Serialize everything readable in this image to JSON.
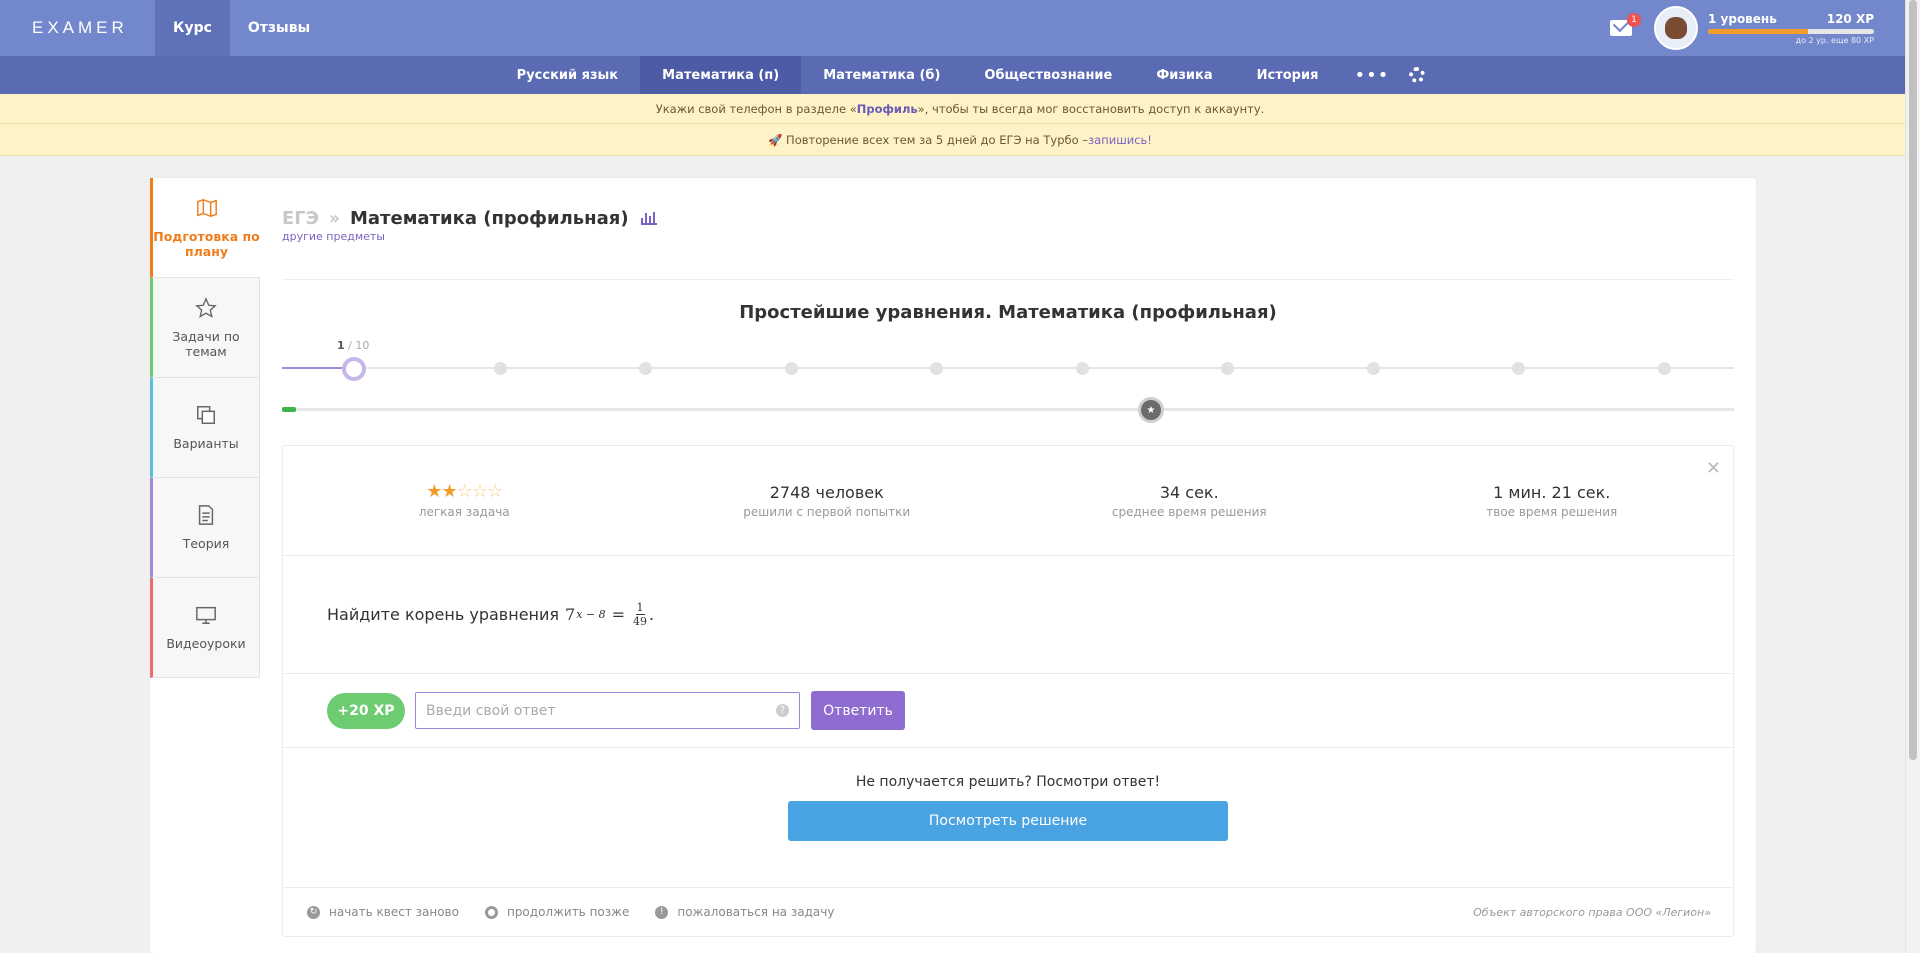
{
  "header": {
    "logo": "EXAMER",
    "nav": [
      {
        "label": "Курс",
        "active": true
      },
      {
        "label": "Отзывы",
        "active": false
      }
    ],
    "mail_count": "1",
    "level_label": "1 уровень",
    "xp_label": "120 XP",
    "level_progress": 0.6,
    "level_note": "до 2 ур. еще 80 XP"
  },
  "subjects": [
    {
      "label": "Русский язык",
      "active": false
    },
    {
      "label": "Математика (п)",
      "active": true
    },
    {
      "label": "Математика (б)",
      "active": false
    },
    {
      "label": "Обществознание",
      "active": false
    },
    {
      "label": "Физика",
      "active": false
    },
    {
      "label": "История",
      "active": false
    }
  ],
  "subjects_more": "•••",
  "notices": {
    "phone_pre": "Укажи свой телефон в разделе «",
    "phone_link": "Профиль",
    "phone_post": "», чтобы ты всегда мог восстановить доступ к аккаунту.",
    "turbo_text": "🚀 Повторение всех тем за 5 дней до ЕГЭ на Турбо – ",
    "turbo_link": "запишись!"
  },
  "sidebar": [
    {
      "label": "Подготовка по плану",
      "color": "#ef7d1c",
      "active": true,
      "icon": "map-icon"
    },
    {
      "label": "Задачи по темам",
      "color": "#6dcc72",
      "active": false,
      "icon": "star-icon"
    },
    {
      "label": "Варианты",
      "color": "#5bc0de",
      "active": false,
      "icon": "copy-icon"
    },
    {
      "label": "Теория",
      "color": "#a48bd8",
      "active": false,
      "icon": "document-icon"
    },
    {
      "label": "Видеоуроки",
      "color": "#ef6a6a",
      "active": false,
      "icon": "monitor-icon"
    }
  ],
  "breadcrumb": {
    "root": "ЕГЭ",
    "separator": "»",
    "subject": "Математика (профильная)",
    "other": "другие предметы"
  },
  "quest": {
    "title": "Простейшие уравнения. Математика (профильная)",
    "current": "1",
    "total": "/ 10",
    "steps_total": 10,
    "overall_progress": 0.01
  },
  "task": {
    "difficulty_stars": 2,
    "difficulty_label": "легкая задача",
    "solved_value": "2748 человек",
    "solved_label": "решили с первой попытки",
    "avg_time_value": "34 сек.",
    "avg_time_label": "среднее время решения",
    "your_time_value": "1 мин. 21 сек.",
    "your_time_label": "твое время решения",
    "question_text": "Найдите корень уравнения",
    "math_base": "7",
    "math_exp": "x − 8",
    "math_eq": "=",
    "math_num": "1",
    "math_den": "49",
    "math_end": ".",
    "xp_reward": "+20 XP",
    "answer_placeholder": "Введи свой ответ",
    "submit_label": "Ответить",
    "help_text": "Не получается решить? Посмотри ответ!",
    "solution_label": "Посмотреть решение"
  },
  "footer": {
    "restart": "начать квест заново",
    "later": "продолжить позже",
    "report": "пожаловаться на задачу",
    "copyright": "Объект авторского права ООО «Легион»"
  }
}
